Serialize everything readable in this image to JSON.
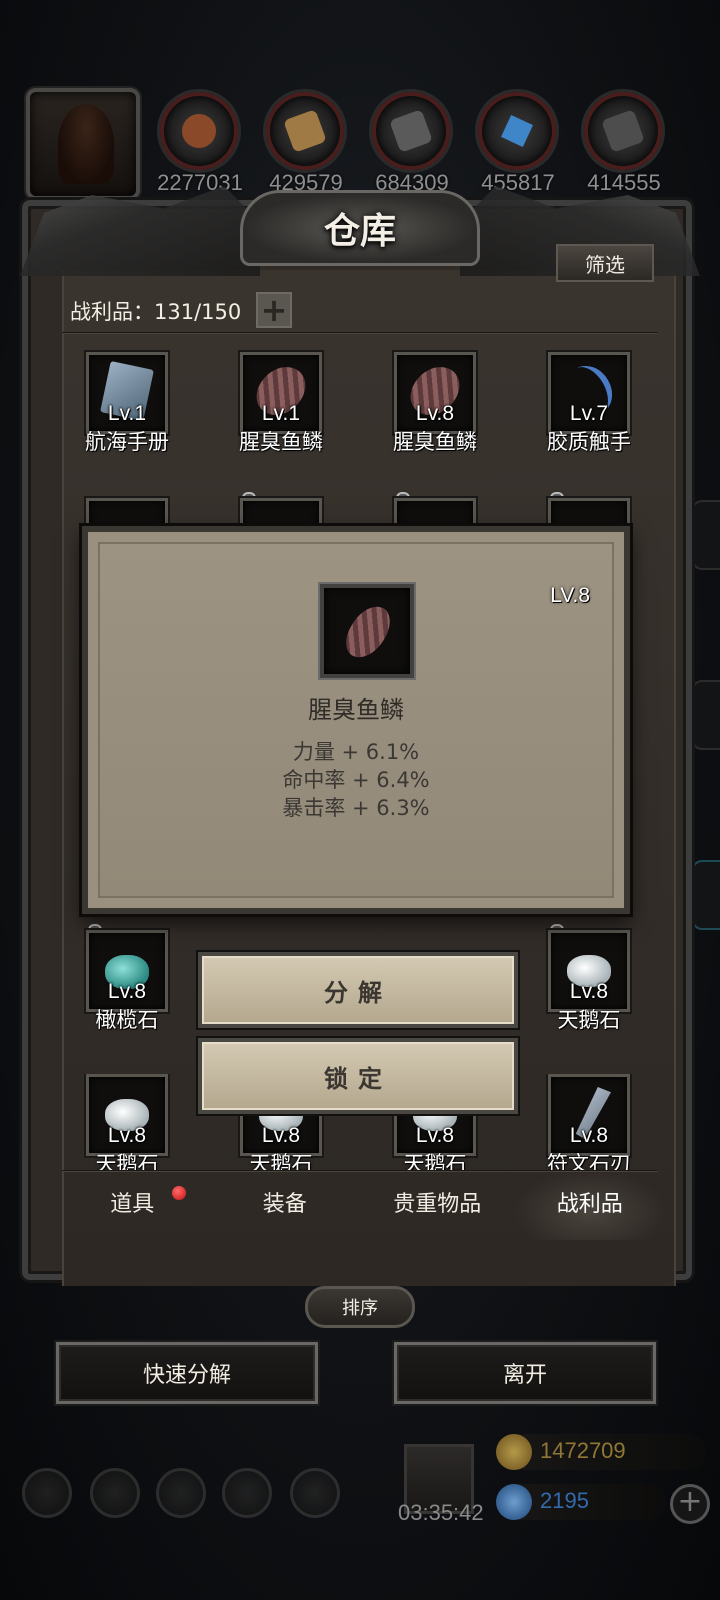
{
  "resources": [
    {
      "icon": "meat-icon",
      "value": "2277031",
      "ring": "#5a1c1c",
      "color": "#8a4a2a"
    },
    {
      "icon": "wood-icon",
      "value": "429579",
      "ring": "#5a1c1c",
      "color": "#a07a44"
    },
    {
      "icon": "iron-icon",
      "value": "684309",
      "ring": "#5a1c1c",
      "color": "#5a5a5a"
    },
    {
      "icon": "crystal-icon",
      "value": "455817",
      "ring": "#5a1c1c",
      "color": "#3e86c8"
    },
    {
      "icon": "ore-icon",
      "value": "414555",
      "ring": "#5a1c1c",
      "color": "#4d4d4d"
    }
  ],
  "warehouse": {
    "title": "仓库",
    "filter_label": "筛选",
    "loot_count": "战利品：131/150"
  },
  "items_row1": [
    {
      "level": "Lv.1",
      "name": "航海手册",
      "art": "book"
    },
    {
      "level": "Lv.1",
      "name": "腥臭鱼鳞",
      "art": "scale"
    },
    {
      "level": "Lv.8",
      "name": "腥臭鱼鳞",
      "art": "scale"
    },
    {
      "level": "Lv.7",
      "name": "胶质触手",
      "art": "tentacle"
    }
  ],
  "items_row3": [
    {
      "level": "Lv.8",
      "name": "橄榄石",
      "art": "jade",
      "locked": true
    },
    {
      "level": "Lv.8",
      "name": "天鹅石",
      "art": "swan",
      "locked": true
    }
  ],
  "items_row4": [
    {
      "level": "Lv.8",
      "name": "天鹅石",
      "art": "swan"
    },
    {
      "level": "Lv.8",
      "name": "天鹅石",
      "art": "swan"
    },
    {
      "level": "Lv.8",
      "name": "天鹅石",
      "art": "swan"
    },
    {
      "level": "Lv.8",
      "name": "符文石刃",
      "art": "blade"
    }
  ],
  "popup": {
    "level": "LV.8",
    "name": "腥臭鱼鳞",
    "stats": [
      "力量 + 6.1%",
      "命中率 + 6.4%",
      "暴击率 + 6.3%"
    ]
  },
  "actions": {
    "decompose": "分解",
    "lock": "锁定"
  },
  "tabs": [
    {
      "label": "道具",
      "badge": true
    },
    {
      "label": "装备",
      "badge": false
    },
    {
      "label": "贵重物品",
      "badge": false
    },
    {
      "label": "战利品",
      "badge": false,
      "active": true
    }
  ],
  "sort_label": "排序",
  "buttons": {
    "quick_decompose": "快速分解",
    "leave": "离开"
  },
  "hud": {
    "timer": "03:35:42",
    "gold": "1472709",
    "gems": "2195",
    "gold_color": "#a88a3a",
    "gem_color": "#3a7bc8"
  }
}
